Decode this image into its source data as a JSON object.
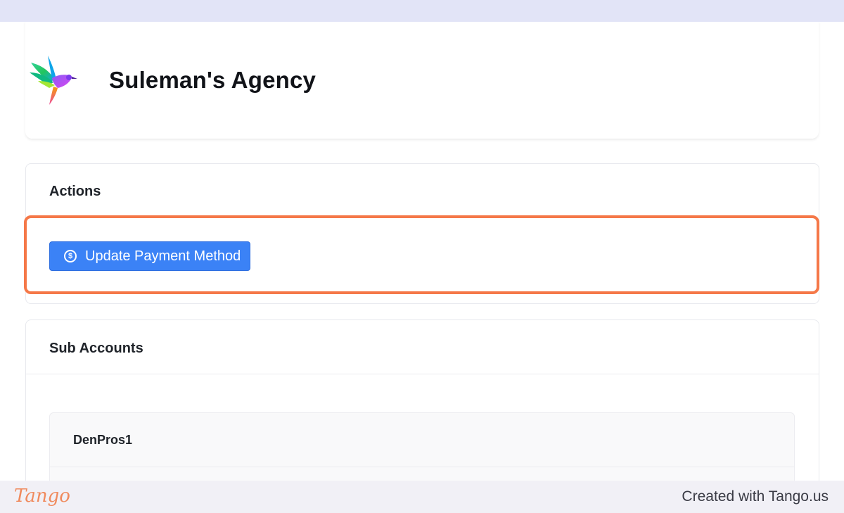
{
  "header": {
    "agency_name": "Suleman's Agency",
    "logo_icon": "hummingbird-logo"
  },
  "actions": {
    "title": "Actions",
    "update_payment_label": "Update Payment Method",
    "button_icon": "dollar-circle-icon",
    "button_color": "#3b82f6"
  },
  "sub_accounts": {
    "title": "Sub Accounts",
    "items": [
      {
        "name": "DenPros1"
      }
    ]
  },
  "footer": {
    "brand": "Tango",
    "credit": "Created with Tango.us"
  },
  "colors": {
    "highlight": "#f57848",
    "top_bar": "#e2e4f7"
  }
}
